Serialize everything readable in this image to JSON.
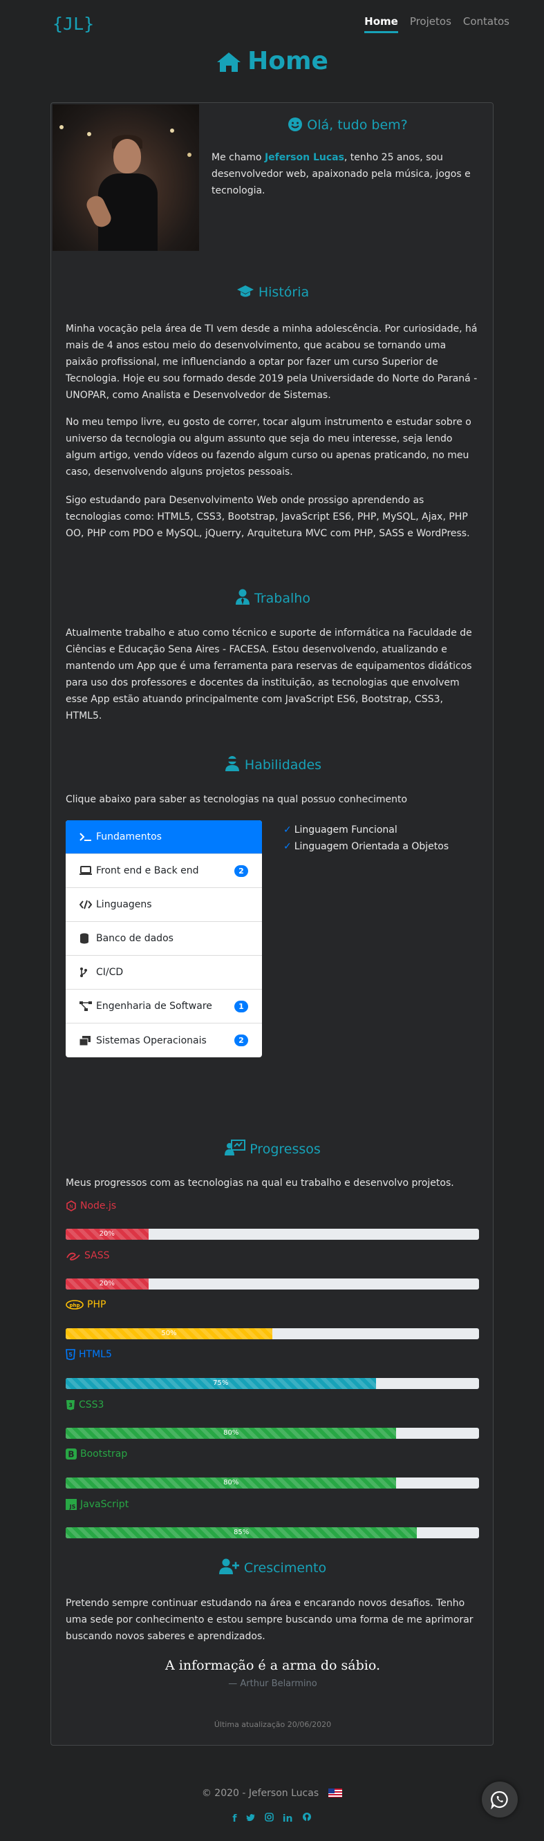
{
  "brand": "{JL}",
  "nav": {
    "items": [
      {
        "label": "Home",
        "active": true
      },
      {
        "label": "Projetos",
        "active": false
      },
      {
        "label": "Contatos",
        "active": false
      }
    ]
  },
  "page_title": "Home",
  "intro": {
    "heading": "Olá, tudo bem?",
    "text_pre": "Me chamo ",
    "name": "Jeferson Lucas",
    "text_post": ", tenho 25 anos, sou desenvolvedor web, apaixonado pela música, jogos e tecnologia."
  },
  "historia": {
    "heading": "História",
    "paragraphs": [
      "Minha vocação pela área de TI vem desde a minha adolescência. Por curiosidade, há mais de 4 anos estou meio do desenvolvimento, que acabou se tornando uma paixão profissional, me influenciando a optar por fazer um curso Superior de Tecnologia. Hoje eu sou formado desde 2019 pela Universidade do Norte do Paraná - UNOPAR, como Analista e Desenvolvedor de Sistemas.",
      "No meu tempo livre, eu gosto de correr, tocar algum instrumento e estudar sobre o universo da tecnologia ou algum assunto que seja do meu interesse, seja lendo algum artigo, vendo vídeos ou fazendo algum curso ou apenas praticando, no meu caso, desenvolvendo alguns projetos pessoais.",
      "Sigo estudando para Desenvolvimento Web onde prossigo aprendendo as tecnologias como: HTML5, CSS3, Bootstrap, JavaScript ES6, PHP, MySQL, Ajax, PHP OO, PHP com PDO e MySQL, jQuerry, Arquitetura MVC com PHP, SASS e WordPress."
    ]
  },
  "trabalho": {
    "heading": "Trabalho",
    "text": "Atualmente trabalho e atuo como técnico e suporte de informática na Faculdade de Ciências e Educação Sena Aires - FACESA. Estou desenvolvendo, atualizando e mantendo um App que é uma ferramenta para reservas de equipamentos didáticos para uso dos professores e docentes da instituição, as tecnologias que envolvem esse App estão atuando principalmente com JavaScript ES6, Bootstrap, CSS3, HTML5."
  },
  "habilidades": {
    "heading": "Habilidades",
    "intro": "Clique abaixo para saber as tecnologias na qual possuo conhecimento",
    "items": [
      {
        "label": "Fundamentos",
        "icon": "terminal-icon",
        "badge": "",
        "active": true
      },
      {
        "label": "Front end e Back end",
        "icon": "laptop-code-icon",
        "badge": "2",
        "active": false
      },
      {
        "label": "Linguagens",
        "icon": "code-icon",
        "badge": "",
        "active": false
      },
      {
        "label": "Banco de dados",
        "icon": "database-icon",
        "badge": "",
        "active": false
      },
      {
        "label": "CI/CD",
        "icon": "code-branch-icon",
        "badge": "",
        "active": false
      },
      {
        "label": "Engenharia de Software",
        "icon": "project-diagram-icon",
        "badge": "1",
        "active": false
      },
      {
        "label": "Sistemas Operacionais",
        "icon": "windows-stack-icon",
        "badge": "2",
        "active": false
      }
    ],
    "checklist": [
      "Linguagem Funcional",
      "Linguagem Orientada a Objetos"
    ]
  },
  "progressos": {
    "heading": "Progressos",
    "intro": "Meus progressos com as tecnologias na qual eu trabalho e desenvolvo projetos.",
    "items": [
      {
        "name": "Node.js",
        "percent": 20,
        "label": "20%",
        "color": "#dc3545",
        "icon": "node-icon"
      },
      {
        "name": "SASS",
        "percent": 20,
        "label": "20%",
        "color": "#dc3545",
        "icon": "sass-icon"
      },
      {
        "name": "PHP",
        "percent": 50,
        "label": "50%",
        "color": "#ffc107",
        "icon": "php-icon"
      },
      {
        "name": "HTML5",
        "percent": 75,
        "label": "75%",
        "color": "#17a2b8",
        "icon": "html5-icon"
      },
      {
        "name": "CSS3",
        "percent": 80,
        "label": "80%",
        "color": "#28a745",
        "icon": "css3-icon"
      },
      {
        "name": "Bootstrap",
        "percent": 80,
        "label": "80%",
        "color": "#28a745",
        "icon": "bootstrap-icon"
      },
      {
        "name": "JavaScript",
        "percent": 85,
        "label": "85%",
        "color": "#28a745",
        "icon": "js-icon"
      }
    ]
  },
  "crescimento": {
    "heading": "Crescimento",
    "text": "Pretendo sempre continuar estudando na área e encarando novos desafios. Tenho uma sede por conhecimento e estou sempre buscando uma forma de me aprimorar buscando novos saberes e aprendizados.",
    "quote": "A informação é a arma do sábio.",
    "quote_author": "— Arthur Belarmino"
  },
  "last_update": "Última atualização 20/06/2020",
  "footer": {
    "copyright": "© 2020 - Jeferson Lucas",
    "socials": [
      "facebook-icon",
      "twitter-icon",
      "instagram-icon",
      "linkedin-icon",
      "github-icon"
    ]
  },
  "colors": {
    "accent": "#17a2b8",
    "primary": "#007bff",
    "background": "#222324"
  }
}
